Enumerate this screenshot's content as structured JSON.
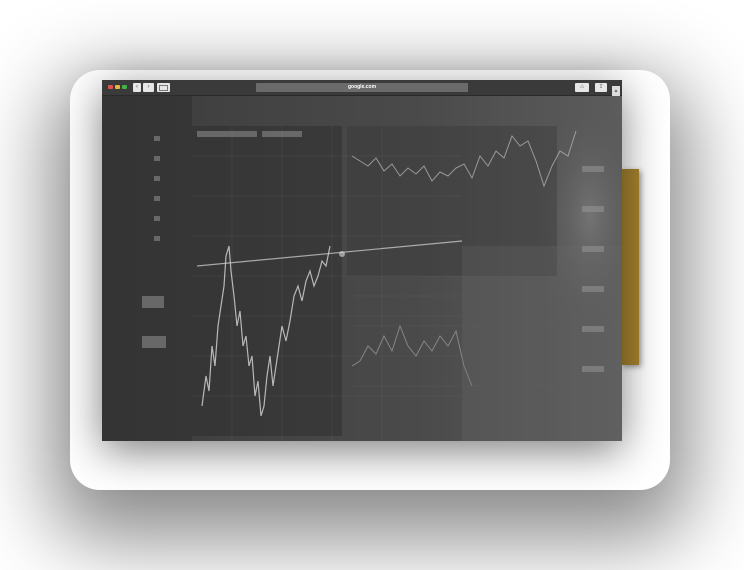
{
  "browser": {
    "url": "google.com",
    "nav": {
      "back_icon": "chevron-left-icon",
      "forward_icon": "chevron-right-icon",
      "sidebar_icon": "sidebar-icon"
    },
    "home_icon": "home-icon",
    "share_icon": "share-icon",
    "colors": {
      "close": "#e0534e",
      "minimize": "#e6b93a",
      "maximize": "#3fb24c",
      "accent_tab": "#a8842f"
    }
  },
  "content": {
    "description_icon": "stock-chart-background"
  }
}
